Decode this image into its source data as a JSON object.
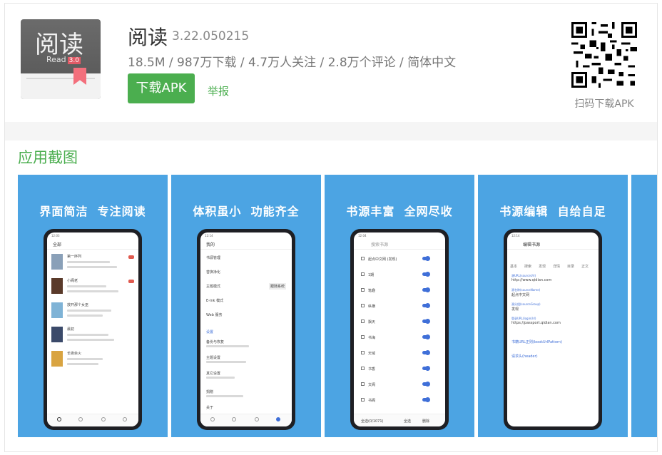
{
  "app": {
    "icon_text": "阅读",
    "icon_sub": "Read",
    "icon_version": "3.0",
    "name": "阅读",
    "version": "3.22.050215",
    "meta": "18.5M / 987万下载 / 4.7万人关注 / 2.8万个评论 / 简体中文",
    "download_label": "下载APK",
    "report_label": "举报",
    "qr_label": "扫码下载APK"
  },
  "section_title": "应用截图",
  "colors": {
    "accent": "#4bae4f",
    "shot_bg": "#4ca4e3",
    "toggle": "#3f6fd8"
  },
  "screenshots": [
    {
      "caption": "界面简洁  专注阅读",
      "time": "12:03",
      "title": "全部",
      "books": [
        "第一序列",
        "小阁老",
        "放开那个女巫",
        "最初",
        "长夜余火"
      ]
    },
    {
      "caption": "体积虽小  功能齐全",
      "time": "12:14",
      "title": "我的",
      "items": [
        "书源管理",
        "替换净化",
        "主题模式",
        "E-Ink 模式",
        "Web 服务",
        "设置",
        "备份与恢复",
        "主题设置",
        "其它设置",
        "捐赠",
        "关于"
      ],
      "theme_button": "跟随系统"
    },
    {
      "caption": "书源丰富  全网尽收",
      "time": "12:04",
      "search_placeholder": "搜索书源",
      "sources": [
        "起点中文网 (发现)",
        "1期",
        "笔趣",
        "纵横",
        "飘天",
        "书海",
        "天域",
        "书香",
        "文阁",
        "书阁"
      ],
      "select_all": "全选(0/1071)",
      "actions": [
        "全选",
        "删除"
      ]
    },
    {
      "caption": "书源编辑  自给自足",
      "time": "12:14",
      "title": "编辑书源",
      "tabs": [
        "基本",
        "搜索",
        "发现",
        "详情",
        "目录",
        "正文"
      ],
      "fields": [
        {
          "label": "源URL(sourceUrl)",
          "value": "http://www.qidian.com"
        },
        {
          "label": "源名称(sourceName)",
          "value": "起点中文网"
        },
        {
          "label": "源分组(sourceGroup)",
          "value": "发现"
        },
        {
          "label": "登录URL(loginUrl)",
          "value": "https://passport.qidian.com"
        },
        {
          "label": "",
          "value": "书籍URL正则(bookUrlPattern)"
        },
        {
          "label": "",
          "value": "请求头(header)"
        }
      ]
    }
  ]
}
